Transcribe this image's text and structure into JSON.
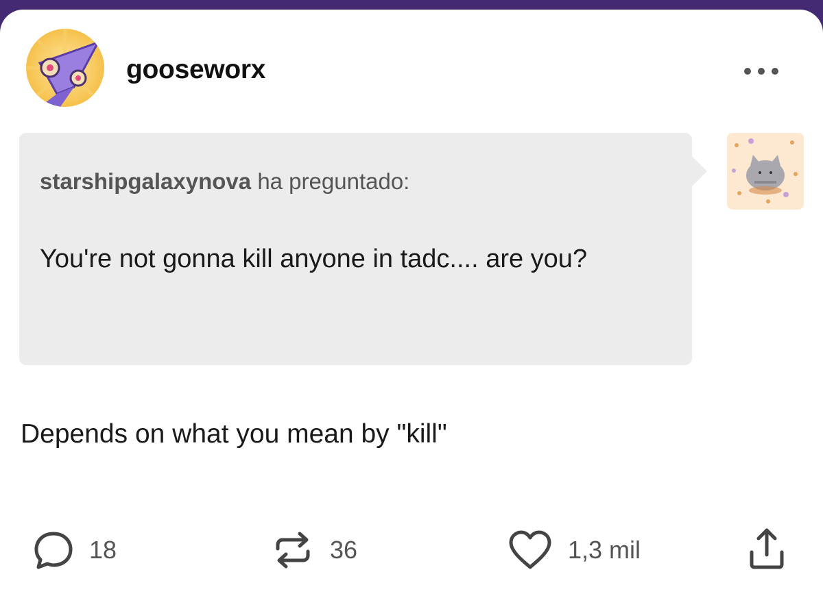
{
  "post": {
    "username": "gooseworx",
    "ask": {
      "asker": "starshipgalaxynova",
      "asked_label": "ha preguntado:",
      "question": "You're not gonna kill anyone in tadc.... are you?"
    },
    "answer": "Depends on what you mean by \"kill\"",
    "actions": {
      "comments": "18",
      "reblogs": "36",
      "likes": "1,3 mil"
    }
  },
  "colors": {
    "header_bar": "#432a72",
    "ask_bg": "#ececec",
    "text": "#1a1a1a"
  },
  "icons": [
    "more-options-icon",
    "comment-icon",
    "reblog-icon",
    "heart-icon",
    "share-icon"
  ]
}
